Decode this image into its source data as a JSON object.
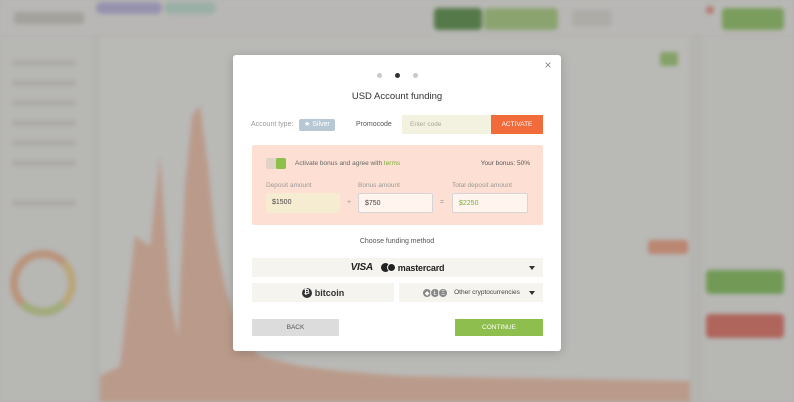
{
  "modal": {
    "title": "USD Account funding",
    "close_icon": "×",
    "steps": {
      "count": 3,
      "active": 2
    },
    "account": {
      "label": "Account type:",
      "badge_icon": "star-icon",
      "badge_label": "Silver"
    },
    "promo": {
      "label": "Promocode",
      "placeholder": "Enter code",
      "value": "",
      "activate_label": "ACTIVATE"
    },
    "bonus": {
      "toggle_on": true,
      "agree_text": "Activate bonus and agree with ",
      "terms_link": "terms",
      "your_bonus": "Your bonus: 50%",
      "deposit_label": "Deposit amount",
      "deposit_value": "$1500",
      "bonus_label": "Bonus amount",
      "bonus_value": "$750",
      "total_label": "Total deposit amount",
      "total_value": "$2250",
      "plus": "+",
      "equals": "="
    },
    "funding": {
      "heading": "Choose funding method",
      "card_visa": "VISA",
      "card_mastercard": "mastercard",
      "bitcoin": "bitcoin",
      "other_crypto": "Other cryptocurrencies"
    },
    "back_label": "BACK",
    "continue_label": "CONTINUE"
  },
  "colors": {
    "accent_orange": "#f26b3a",
    "accent_green": "#8dbe4e",
    "bonus_bg": "#fde0d3",
    "silver_badge": "#b7c8d4"
  }
}
